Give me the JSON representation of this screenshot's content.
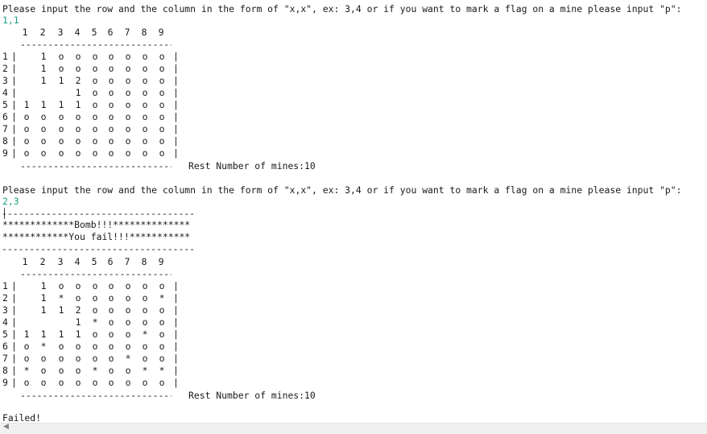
{
  "prompt": "Please input the row and the column in the form of \"x,x\", ex: 3,4 or if you want to mark a flag on a mine please input \"p\":",
  "colors": {
    "input_text": "#1e9e84",
    "text": "#1a1a1a",
    "background": "#ffffff"
  },
  "col_header": [
    "1",
    "2",
    "3",
    "4",
    "5",
    "6",
    "7",
    "8",
    "9"
  ],
  "row_labels": [
    "1",
    "2",
    "3",
    "4",
    "5",
    "6",
    "7",
    "8",
    "9"
  ],
  "dash_line": "----------------------------",
  "sep_line": "------------------------------------------",
  "round1": {
    "input": "1,1",
    "board": [
      [
        " ",
        "1",
        "o",
        "o",
        "o",
        "o",
        "o",
        "o",
        "o"
      ],
      [
        " ",
        "1",
        "o",
        "o",
        "o",
        "o",
        "o",
        "o",
        "o"
      ],
      [
        " ",
        "1",
        "1",
        "2",
        "o",
        "o",
        "o",
        "o",
        "o"
      ],
      [
        " ",
        " ",
        " ",
        "1",
        "o",
        "o",
        "o",
        "o",
        "o"
      ],
      [
        "1",
        "1",
        "1",
        "1",
        "o",
        "o",
        "o",
        "o",
        "o"
      ],
      [
        "o",
        "o",
        "o",
        "o",
        "o",
        "o",
        "o",
        "o",
        "o"
      ],
      [
        "o",
        "o",
        "o",
        "o",
        "o",
        "o",
        "o",
        "o",
        "o"
      ],
      [
        "o",
        "o",
        "o",
        "o",
        "o",
        "o",
        "o",
        "o",
        "o"
      ],
      [
        "o",
        "o",
        "o",
        "o",
        "o",
        "o",
        "o",
        "o",
        "o"
      ]
    ],
    "mines_text": "Rest Number of mines:10"
  },
  "round2": {
    "input": "2,3",
    "bomb_line": "*************Bomb!!!**************",
    "fail_line": "************You fail!!!***********",
    "board": [
      [
        " ",
        "1",
        "o",
        "o",
        "o",
        "o",
        "o",
        "o",
        "o"
      ],
      [
        " ",
        "1",
        "*",
        "o",
        "o",
        "o",
        "o",
        "o",
        "*"
      ],
      [
        " ",
        "1",
        "1",
        "2",
        "o",
        "o",
        "o",
        "o",
        "o"
      ],
      [
        " ",
        " ",
        " ",
        "1",
        "*",
        "o",
        "o",
        "o",
        "o"
      ],
      [
        "1",
        "1",
        "1",
        "1",
        "o",
        "o",
        "o",
        "*",
        "o"
      ],
      [
        "o",
        "*",
        "o",
        "o",
        "o",
        "o",
        "o",
        "o",
        "o"
      ],
      [
        "o",
        "o",
        "o",
        "o",
        "o",
        "o",
        "*",
        "o",
        "o"
      ],
      [
        "*",
        "o",
        "o",
        "o",
        "*",
        "o",
        "o",
        "*",
        "*"
      ],
      [
        "o",
        "o",
        "o",
        "o",
        "o",
        "o",
        "o",
        "o",
        "o"
      ]
    ],
    "mines_text": "Rest Number of mines:10"
  },
  "final": "Failed!",
  "scrollbar": {
    "left_arrow": "◀"
  }
}
